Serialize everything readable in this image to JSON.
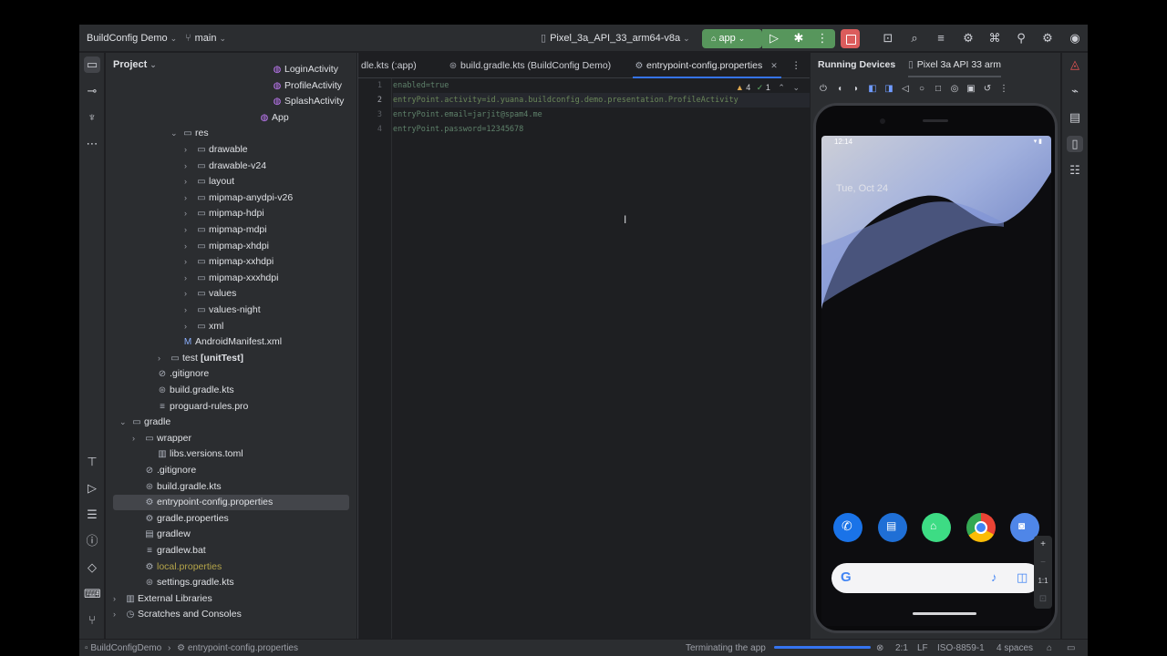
{
  "titlebar": {
    "project_name": "BuildConfig Demo",
    "branch": "main",
    "device": "Pixel_3a_API_33_arm64-v8a",
    "run_config": "app"
  },
  "project_panel": {
    "title": "Project",
    "rows": [
      {
        "label": "LoginActivity",
        "icon": "kotlin-class-icon"
      },
      {
        "label": "ProfileActivity",
        "icon": "kotlin-class-icon"
      },
      {
        "label": "SplashActivity",
        "icon": "kotlin-class-icon"
      },
      {
        "label": "App",
        "icon": "kotlin-class-icon"
      },
      {
        "label": "res",
        "icon": "folder-icon",
        "expanded": true
      },
      {
        "label": "drawable",
        "icon": "folder-icon"
      },
      {
        "label": "drawable-v24",
        "icon": "folder-icon"
      },
      {
        "label": "layout",
        "icon": "folder-icon"
      },
      {
        "label": "mipmap-anydpi-v26",
        "icon": "folder-icon"
      },
      {
        "label": "mipmap-hdpi",
        "icon": "folder-icon"
      },
      {
        "label": "mipmap-mdpi",
        "icon": "folder-icon"
      },
      {
        "label": "mipmap-xhdpi",
        "icon": "folder-icon"
      },
      {
        "label": "mipmap-xxhdpi",
        "icon": "folder-icon"
      },
      {
        "label": "mipmap-xxxhdpi",
        "icon": "folder-icon"
      },
      {
        "label": "values",
        "icon": "folder-icon"
      },
      {
        "label": "values-night",
        "icon": "folder-icon"
      },
      {
        "label": "xml",
        "icon": "folder-icon"
      },
      {
        "label": "AndroidManifest.xml",
        "icon": "manifest-icon"
      },
      {
        "label": "test",
        "suffix": "[unitTest]",
        "icon": "folder-icon"
      },
      {
        "label": ".gitignore",
        "icon": "gitignore-icon"
      },
      {
        "label": "build.gradle.kts",
        "icon": "gradle-icon"
      },
      {
        "label": "proguard-rules.pro",
        "icon": "text-file-icon"
      },
      {
        "label": "gradle",
        "icon": "folder-icon",
        "expanded": true
      },
      {
        "label": "wrapper",
        "icon": "folder-icon"
      },
      {
        "label": "libs.versions.toml",
        "icon": "toml-icon"
      },
      {
        "label": ".gitignore",
        "icon": "gitignore-icon"
      },
      {
        "label": "build.gradle.kts",
        "icon": "gradle-icon"
      },
      {
        "label": "entrypoint-config.properties",
        "icon": "properties-icon",
        "selected": true
      },
      {
        "label": "gradle.properties",
        "icon": "properties-icon"
      },
      {
        "label": "gradlew",
        "icon": "script-icon"
      },
      {
        "label": "gradlew.bat",
        "icon": "text-file-icon"
      },
      {
        "label": "local.properties",
        "icon": "properties-icon",
        "ignored": true
      },
      {
        "label": "settings.gradle.kts",
        "icon": "gradle-icon"
      },
      {
        "label": "External Libraries",
        "icon": "library-icon"
      },
      {
        "label": "Scratches and Consoles",
        "icon": "scratch-icon"
      }
    ]
  },
  "editor": {
    "tabs": [
      {
        "label": "dle.kts (:app)"
      },
      {
        "label": "build.gradle.kts (BuildConfig Demo)"
      },
      {
        "label": "entrypoint-config.properties",
        "active": true
      }
    ],
    "inspections": {
      "warnings": "4",
      "weak": "1"
    },
    "lines": [
      {
        "n": "1",
        "text": "enabled=true"
      },
      {
        "n": "2",
        "text": "entryPoint.activity=id.yuana.buildconfig.demo.presentation.ProfileActivity"
      },
      {
        "n": "3",
        "text": "entryPoint.email=jarjit@spam4.me"
      },
      {
        "n": "4",
        "text": "entryPoint.password=12345678"
      }
    ]
  },
  "devices": {
    "title": "Running Devices",
    "tab": "Pixel 3a API 33 arm",
    "phone": {
      "time": "12:14",
      "date": "Tue, Oct 24"
    },
    "zoom_label": "1:1"
  },
  "statusbar": {
    "breadcrumb_project": "BuildConfigDemo",
    "breadcrumb_file": "entrypoint-config.properties",
    "task": "Terminating the app",
    "progress": 1.0,
    "position": "2:1",
    "line_sep": "LF",
    "encoding": "ISO-8859-1",
    "indent": "4 spaces"
  }
}
